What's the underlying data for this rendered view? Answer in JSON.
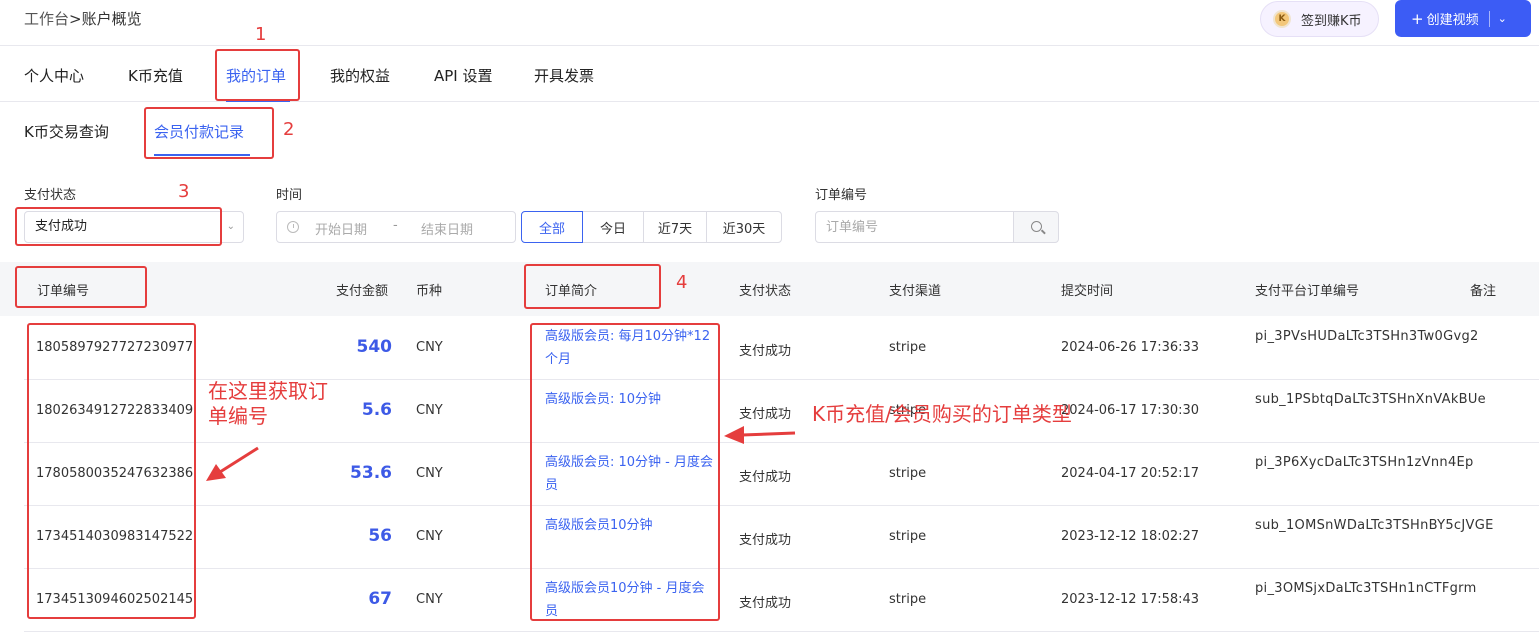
{
  "header": {
    "breadcrumb_root": "工作台",
    "breadcrumb_current": ">账户概览",
    "checkin_label": "签到赚K币",
    "create_label": "创建视频"
  },
  "tabs": [
    {
      "label": "个人中心",
      "active": false
    },
    {
      "label": "K币充值",
      "active": false
    },
    {
      "label": "我的订单",
      "active": true
    },
    {
      "label": "我的权益",
      "active": false
    },
    {
      "label": "API 设置",
      "active": false
    },
    {
      "label": "开具发票",
      "active": false
    }
  ],
  "subtabs": [
    {
      "label": "K币交易查询",
      "active": false
    },
    {
      "label": "会员付款记录",
      "active": true
    }
  ],
  "filters": {
    "status_label": "支付状态",
    "status_value": "支付成功",
    "time_label": "时间",
    "start_placeholder": "开始日期",
    "range_separator": "-",
    "end_placeholder": "结束日期",
    "quick_ranges": [
      {
        "label": "全部",
        "active": true
      },
      {
        "label": "今日",
        "active": false
      },
      {
        "label": "近7天",
        "active": false
      },
      {
        "label": "近30天",
        "active": false
      }
    ],
    "order_label": "订单编号",
    "order_placeholder": "订单编号"
  },
  "table": {
    "columns": [
      "订单编号",
      "支付金额",
      "币种",
      "订单简介",
      "支付状态",
      "支付渠道",
      "提交时间",
      "支付平台订单编号",
      "备注"
    ],
    "rows": [
      {
        "order_id": "1805897927727230977",
        "amount": "540",
        "currency": "CNY",
        "summary": "高级版会员: 每月10分钟*12个月",
        "status": "支付成功",
        "channel": "stripe",
        "submitted": "2024-06-26 17:36:33",
        "platform_id": "pi_3PVsHUDaLTc3TSHn3Tw0Gvg2",
        "note": ""
      },
      {
        "order_id": "1802634912722833409",
        "amount": "5.6",
        "currency": "CNY",
        "summary": "高级版会员: 10分钟",
        "status": "支付成功",
        "channel": "stripe",
        "submitted": "2024-06-17 17:30:30",
        "platform_id": "sub_1PSbtqDaLTc3TSHnXnVAkBUe",
        "note": ""
      },
      {
        "order_id": "1780580035247632386",
        "amount": "53.6",
        "currency": "CNY",
        "summary": "高级版会员: 10分钟 - 月度会员",
        "status": "支付成功",
        "channel": "stripe",
        "submitted": "2024-04-17 20:52:17",
        "platform_id": "pi_3P6XycDaLTc3TSHn1zVnn4Ep",
        "note": ""
      },
      {
        "order_id": "1734514030983147522",
        "amount": "56",
        "currency": "CNY",
        "summary": "高级版会员10分钟",
        "status": "支付成功",
        "channel": "stripe",
        "submitted": "2023-12-12 18:02:27",
        "platform_id": "sub_1OMSnWDaLTc3TSHnBY5cJVGE",
        "note": ""
      },
      {
        "order_id": "1734513094602502145",
        "amount": "67",
        "currency": "CNY",
        "summary": "高级版会员10分钟 - 月度会员",
        "status": "支付成功",
        "channel": "stripe",
        "submitted": "2023-12-12 17:58:43",
        "platform_id": "pi_3OMSjxDaLTc3TSHn1nCTFgrm",
        "note": ""
      }
    ]
  },
  "annotations": {
    "marker_1": "1",
    "marker_2": "2",
    "marker_3": "3",
    "marker_4": "4",
    "order_id_note": "在这里获取订单编号",
    "order_type_note": "K币充值/会员购买的订单类型",
    "color": "#e53d3d"
  },
  "colors": {
    "accent": "#3b63f0",
    "primary_button": "#3c5cf5",
    "amount": "#3d5ae6"
  },
  "icons": {
    "coin": "coin-icon",
    "plus": "plus-icon",
    "chevron": "chevron-down-icon",
    "clock": "clock-icon",
    "search": "search-icon",
    "arrow": "arrow-icon"
  }
}
